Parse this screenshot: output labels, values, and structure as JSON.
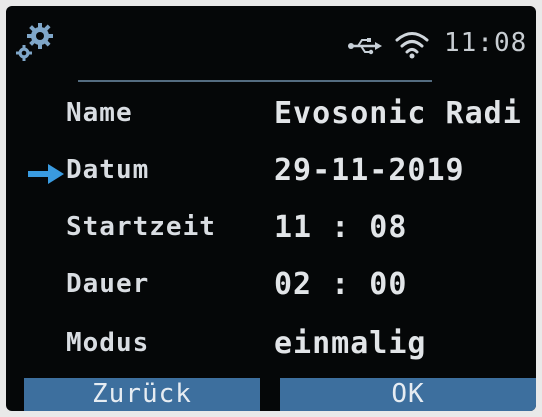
{
  "statusbar": {
    "settings_icon": "gear-icon",
    "usb_icon": "usb-icon",
    "wifi_icon": "wifi-icon",
    "time": "11:08"
  },
  "form": {
    "selected_row": "Datum",
    "rows": [
      {
        "label": "Name",
        "value": "Evosonic Radi"
      },
      {
        "label": "Datum",
        "value": "29-11-2019"
      },
      {
        "label": "Startzeit",
        "value": "11 : 08"
      },
      {
        "label": "Dauer",
        "value": "02 : 00"
      },
      {
        "label": "Modus",
        "value": "einmalig"
      }
    ]
  },
  "softkeys": {
    "back_label": "Zurück",
    "ok_label": "OK"
  },
  "colors": {
    "background": "#050708",
    "accent": "#3d6f9e",
    "selection_arrow": "#3a9be0"
  }
}
